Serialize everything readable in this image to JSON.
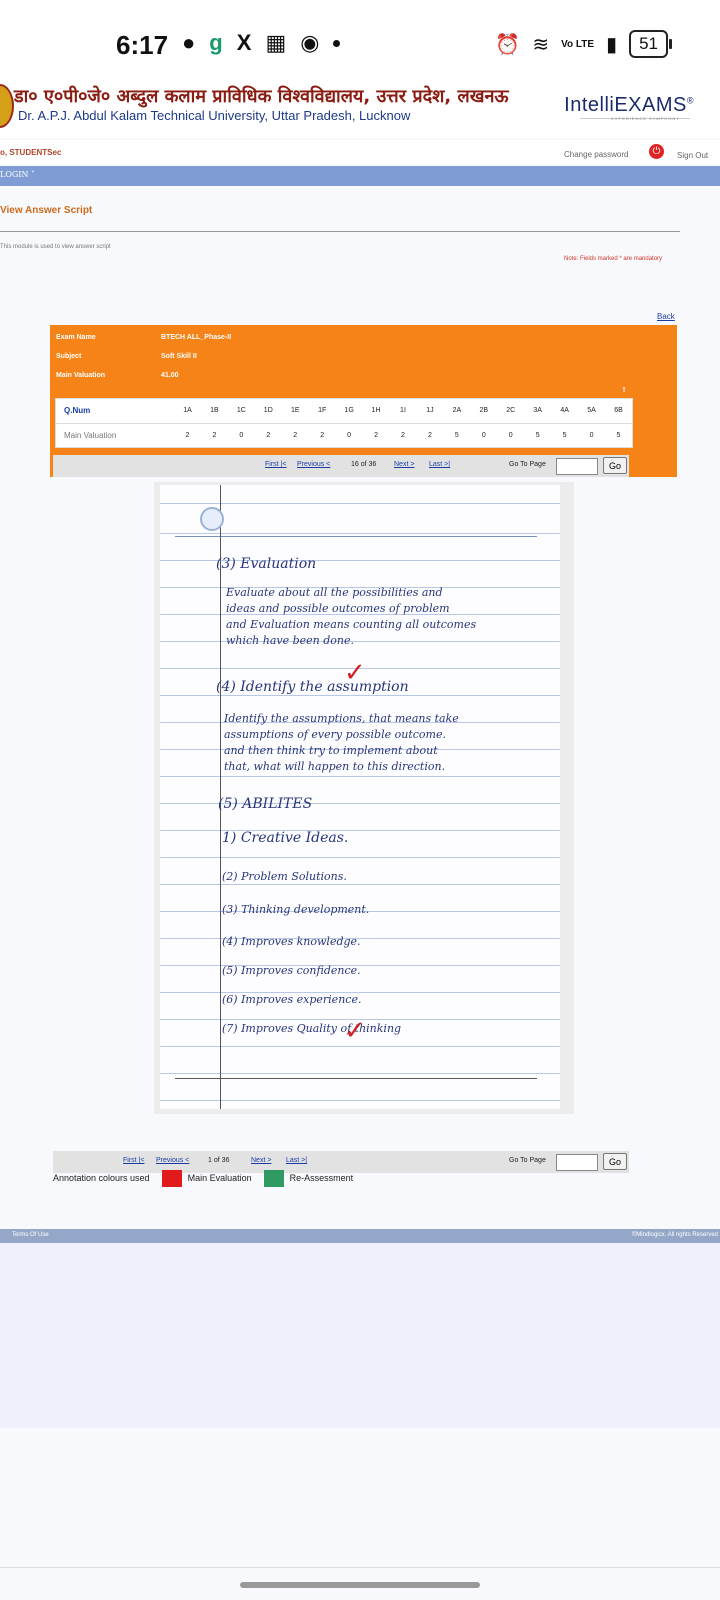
{
  "status_bar": {
    "time": "6:17",
    "left_icons": [
      "chat-bubble-icon",
      "g-app-icon",
      "x-app-icon",
      "gallery-icon",
      "chrome-icon",
      "dot-icon"
    ],
    "network": "Vo LTE",
    "battery": "51"
  },
  "header": {
    "university_hindi": "डा० ए०पी०जे० अब्दुल कलाम प्राविधिक विश्वविद्यालय, उत्तर प्रदेश, लखनऊ",
    "university_english": "Dr. A.P.J. Abdul Kalam Technical University, Uttar Pradesh, Lucknow",
    "brand": "IntelliEXAMS",
    "brand_tagline": "EXPERIENCE SYMPHONY",
    "user": "o, STUDENTSec",
    "change_password": "Change password",
    "sign_out": "Sign Out"
  },
  "menu": {
    "login": "LOGIN ˅"
  },
  "page": {
    "title": "View Answer Script",
    "description": "This module is used to view answer script",
    "mandatory_note": "Note: Fields marked * are mandatory",
    "back": "Back"
  },
  "exam": {
    "exam_name_label": "Exam Name",
    "exam_name": "BTECH ALL_Phase-II",
    "subject_label": "Subject",
    "subject": "Soft Skill II",
    "valuation_label": "Main Valuation",
    "valuation": "41.00"
  },
  "marks_table": {
    "head_label": "Q.Num",
    "value_label": "Main Valuation",
    "questions": [
      "1A",
      "1B",
      "1C",
      "1D",
      "1E",
      "1F",
      "1G",
      "1H",
      "1I",
      "1J",
      "2A",
      "2B",
      "2C",
      "3A",
      "4A",
      "5A",
      "6B"
    ],
    "values": [
      "2",
      "2",
      "0",
      "2",
      "2",
      "2",
      "0",
      "2",
      "2",
      "2",
      "5",
      "0",
      "0",
      "5",
      "5",
      "0",
      "5"
    ]
  },
  "pager_top": {
    "first": "First |<",
    "previous": "Previous <",
    "page": "16 of 36",
    "next": "Next >",
    "last": "Last >|",
    "goto_label": "Go To Page",
    "goto_value": "",
    "go": "Go"
  },
  "pager_bottom": {
    "first": "First |<",
    "previous": "Previous <",
    "page": "1 of 36",
    "next": "Next >",
    "last": "Last >|",
    "goto_label": "Go To Page",
    "goto_value": "",
    "go": "Go"
  },
  "answer_script": {
    "lines": [
      "(3) Evaluation",
      "Evaluate about all the possibilities and",
      "ideas and possible outcomes of problem",
      "and Evaluation means counting all outcomes",
      "which have been done.",
      "(4) Identify the assumption",
      "Identify the assumptions, that means take",
      "assumptions of every possible outcome.",
      "and then think try to implement about",
      "that, what will happen to this direction.",
      "(5) ABILITES",
      "1) Creative Ideas.",
      "(2) Problem Solutions.",
      "(3) Thinking development.",
      "(4) Improves knowledge.",
      "(5) Improves confidence.",
      "(6) Improves experience.",
      "(7) Improves Quality of thinking"
    ]
  },
  "annotation": {
    "label": "Annotation colours used",
    "main": "Main Evaluation",
    "main_color": "#e11b1b",
    "reassessment": "Re-Assessment",
    "reassessment_color": "#2f9b62"
  },
  "footer": {
    "terms": "Terms Of Use",
    "copyright": "©Mindlogicx. All rights Reserved"
  },
  "colors": {
    "panel": "#f58318",
    "menubar": "#7f9cd4",
    "title": "#cf6b1c"
  }
}
